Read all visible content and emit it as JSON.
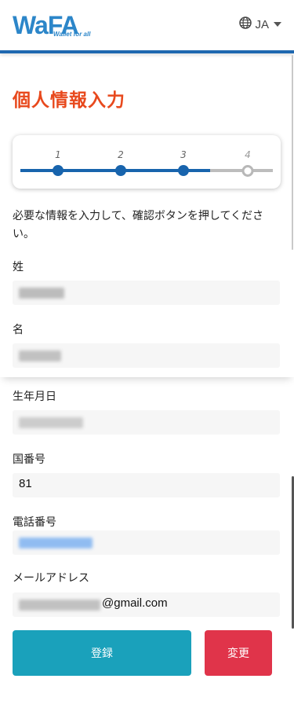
{
  "header": {
    "logo_text": "WaFA",
    "logo_sub": "Wallet for all",
    "language": "JA",
    "icons": [
      "globe-icon",
      "caret-down-icon"
    ],
    "accent": "#1f68b0"
  },
  "page": {
    "title": "個人情報入力",
    "title_color": "#e8491d",
    "instruction": "必要な情報を入力して、確認ボタンを押してください。"
  },
  "stepper": {
    "steps": [
      "1",
      "2",
      "3",
      "4"
    ],
    "current": 3,
    "active_color": "#1864ad"
  },
  "form": {
    "last_name": {
      "label": "姓"
    },
    "first_name": {
      "label": "名"
    },
    "birth_date": {
      "label": "生年月日"
    },
    "country_code": {
      "label": "国番号",
      "value": "81"
    },
    "phone": {
      "label": "電話番号"
    },
    "email": {
      "label": "メールアドレス",
      "domain": "@gmail.com"
    }
  },
  "buttons": {
    "submit": "登録",
    "change": "変更",
    "submit_color": "#1aa1bb",
    "change_color": "#e0344a"
  }
}
